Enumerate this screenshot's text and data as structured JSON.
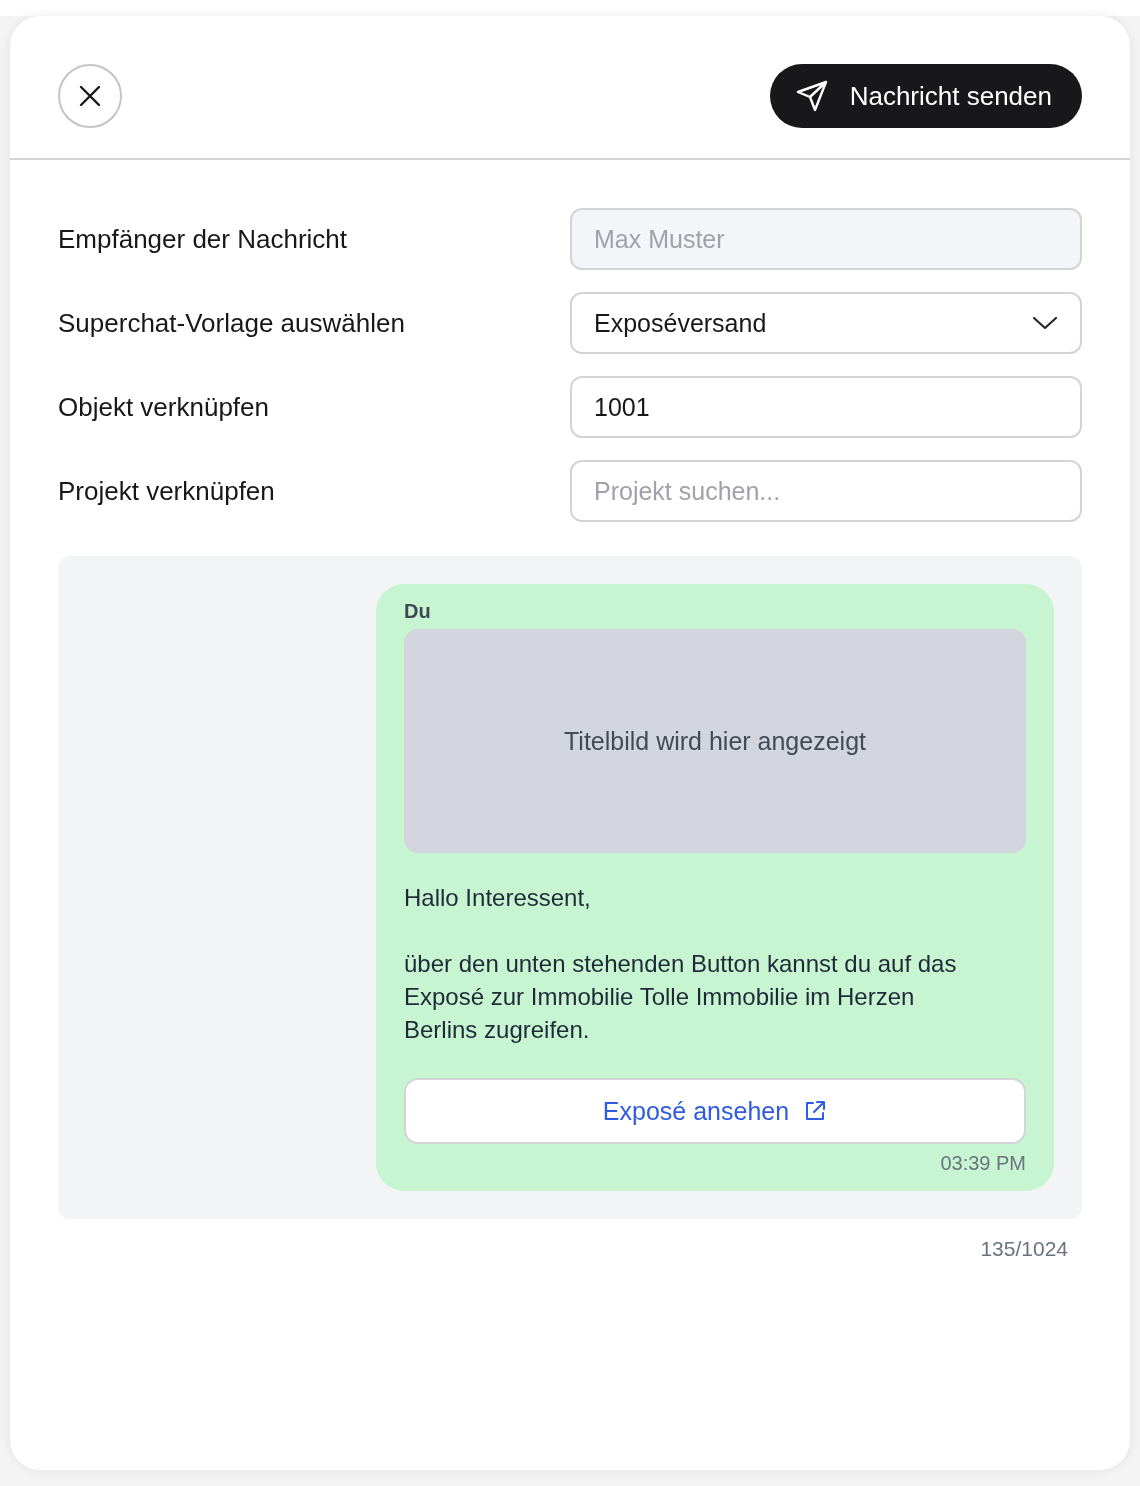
{
  "header": {
    "send_button": {
      "label": "Nachricht senden"
    }
  },
  "fields": [
    {
      "label": "Empfänger der Nachricht",
      "kind": "disabled",
      "placeholder": "Max Muster"
    },
    {
      "label": "Superchat-Vorlage auswählen",
      "kind": "select",
      "value": "Exposéversand"
    },
    {
      "label": "Objekt verknüpfen",
      "kind": "input",
      "value": "1001"
    },
    {
      "label": "Projekt verknüpfen",
      "kind": "input",
      "placeholder": "Projekt suchen..."
    }
  ],
  "preview": {
    "sender": "Du",
    "image_caption": "Titelbild wird hier angezeigt",
    "paragraphs": [
      "Hallo Interessent,",
      "über den unten stehenden Button kannst du auf das Exposé zur Immobilie Tolle Immobilie im Herzen Berlins zugreifen."
    ],
    "link_button": {
      "label": "Exposé ansehen"
    },
    "time": "03:39 PM"
  },
  "counter": "135/1024"
}
